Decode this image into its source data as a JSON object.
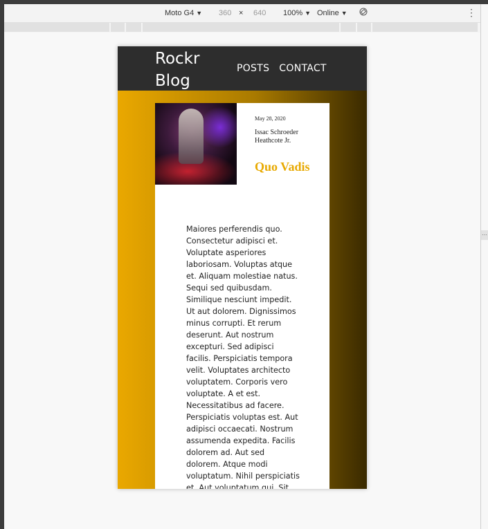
{
  "devtools": {
    "device": "Moto G4",
    "width": "360",
    "times": "×",
    "height": "640",
    "zoom": "100%",
    "network": "Online",
    "caret": "▼",
    "more": "⋮"
  },
  "site": {
    "brand_line1": "Rockr",
    "brand_line2": "Blog",
    "nav": [
      "POSTS",
      "CONTACT"
    ]
  },
  "post": {
    "date": "May 28, 2020",
    "author": "Issac Schroeder Heathcote Jr.",
    "title": "Quo Vadis",
    "body": "Maiores perferendis quo. Consectetur adipisci et. Voluptate asperiores laboriosam. Voluptas atque et. Aliquam molestiae natus. Sequi sed quibusdam. Similique nesciunt impedit. Ut aut dolorem. Dignissimos minus corrupti. Et rerum deserunt. Aut nostrum excepturi. Sed adipisci facilis. Perspiciatis tempora velit. Voluptates architecto voluptatem. Corporis vero voluptate. A et est. Necessitatibus ad facere. Perspiciatis voluptas est. Aut adipisci occaecati. Nostrum assumenda expedita. Facilis dolorem ad. Aut sed dolorem. Atque modi voluptatum. Nihil perspiciatis et. Aut voluptatum qui. Sit"
  },
  "colors": {
    "accent": "#e8a900",
    "header_bg": "#2d2d2d"
  }
}
